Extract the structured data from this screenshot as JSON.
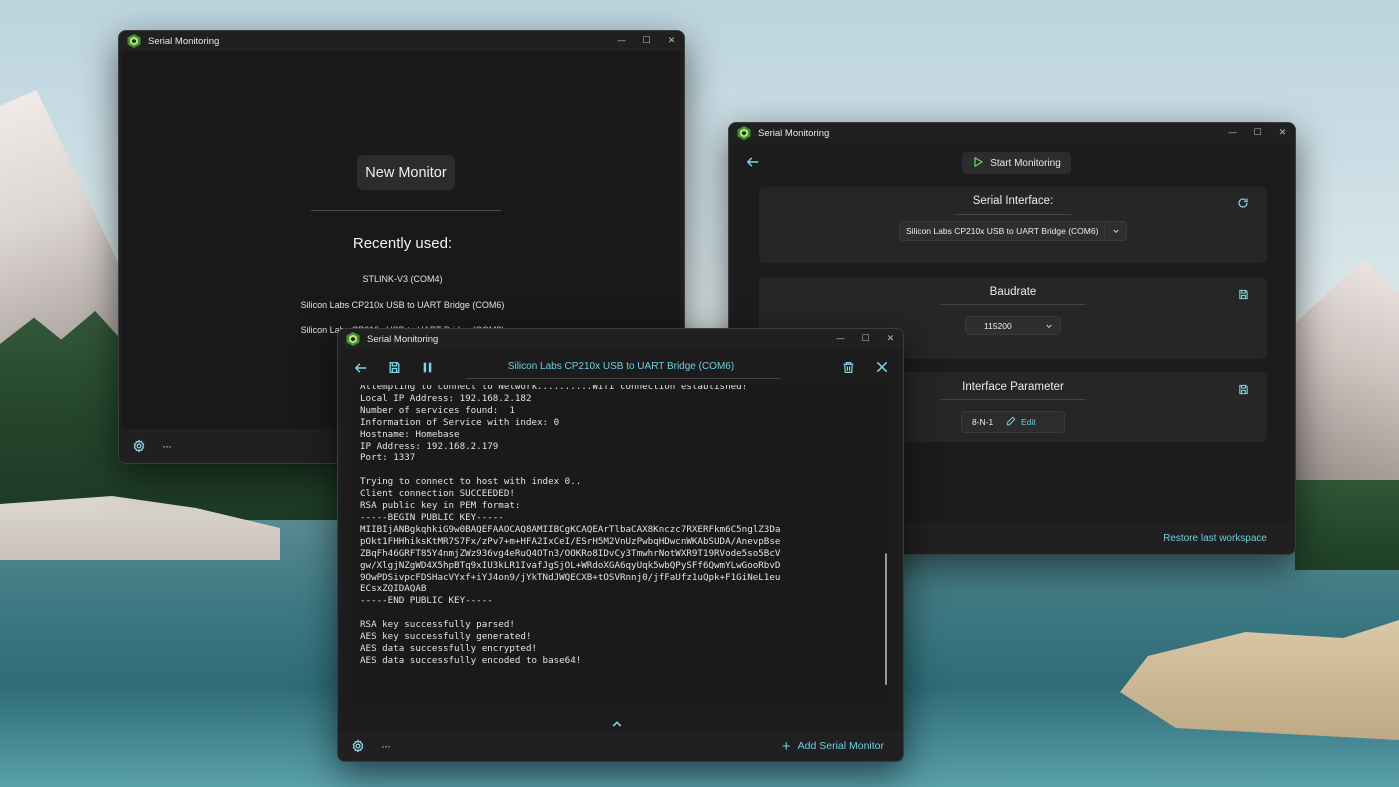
{
  "app": {
    "window_title": "Serial Monitoring",
    "minimize_glyph": "—",
    "maximize_glyph": "☐",
    "close_glyph": "✕",
    "accent_color": "#6fcde0"
  },
  "home_window": {
    "new_monitor_label": "New Monitor",
    "recently_used_title": "Recently used:",
    "recent_items": [
      "STLINK-V3 (COM4)",
      "Silicon Labs CP210x USB to UART Bridge (COM6)",
      "Silicon Labs CP210x USB to UART Bridge (COM8)"
    ],
    "more_glyph": "···"
  },
  "settings_window": {
    "start_monitoring_label": "Start Monitoring",
    "serial_interface": {
      "title": "Serial Interface:",
      "selected": "Silicon Labs CP210x USB to UART Bridge (COM6)"
    },
    "baudrate": {
      "title": "Baudrate",
      "selected": "115200"
    },
    "interface_parameter": {
      "title": "Interface Parameter",
      "value": "8-N-1",
      "edit_label": "Edit"
    },
    "restore_label": "Restore last workspace"
  },
  "monitor_window": {
    "port_title": "Silicon Labs CP210x USB to UART Bridge (COM6)",
    "add_monitor_label": "Add Serial Monitor",
    "more_glyph": "···",
    "console_lines": [
      "Attempting to connect to Network..........Wifi connection established!",
      "Local IP Address: 192.168.2.182",
      "Number of services found:  1",
      "Information of Service with index: 0",
      "Hostname: Homebase",
      "IP Address: 192.168.2.179",
      "Port: 1337",
      "",
      "Trying to connect to host with index 0..",
      "Client connection SUCCEEDED!",
      "RSA public key in PEM format:",
      "-----BEGIN PUBLIC KEY-----",
      "MIIBIjANBgkqhkiG9w0BAQEFAAOCAQ8AMIIBCgKCAQEArTlbaCAX8Knczc7RXERFkm6C5nglZ3Da",
      "pOkt1FHHhiksKtMR7S7Fx/zPv7+m+HFA2IxCeI/ESrH5M2VnUzPwbqHDwcnWKAbSUDA/AnevpBse",
      "ZBqFh46GRFT85Y4nmjZWz936vg4eRuQ4OTn3/OOKRo8IDvCy3TmwhrNotWXR9T19RVode5so5BcV",
      "gw/XlgjNZgWD4X5hpBTq9xIU3kLR1IvafJgSjOL+WRdoXGA6qyUqk5wbQPySFf6QwmYLwGooRbvD",
      "9OwPDSivpcFDSHacVYxf+iYJ4on9/jYkTNdJWQECXB+tOSVRnnj0/jfFaUfz1uQpk+F1GiNeL1eu",
      "ECsxZQIDAQAB",
      "-----END PUBLIC KEY-----",
      "",
      "RSA key successfully parsed!",
      "AES key successfully generated!",
      "AES data successfully encrypted!",
      "AES data successfully encoded to base64!"
    ]
  }
}
